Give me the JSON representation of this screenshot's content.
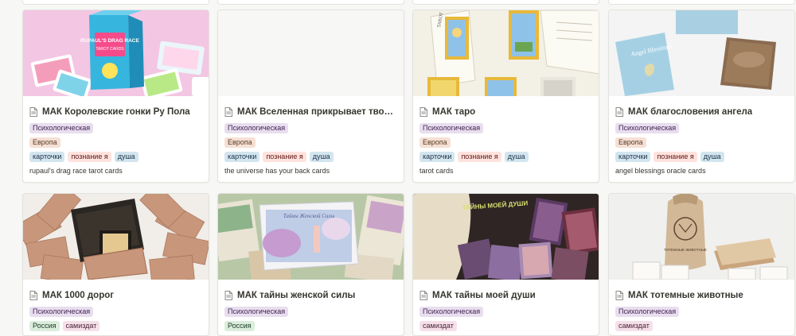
{
  "cards": [
    {
      "title": "МАК Королевские гонки Ру Пола",
      "category": "Психологическая",
      "region": "Европа",
      "tags": [
        "карточки",
        "познание я",
        "душа"
      ],
      "subtitle": "rupaul's drag race tarot cards",
      "cover_text": "RUPAUL'S DRAG RACE"
    },
    {
      "title": "МАК Вселенная прикрывает твою спину",
      "category": "Психологическая",
      "region": "Европа",
      "tags": [
        "карточки",
        "познание я",
        "душа"
      ],
      "subtitle": "the universe has your back cards",
      "cover_text": ""
    },
    {
      "title": "МАК таро",
      "category": "Психологическая",
      "region": "Европа",
      "tags": [
        "карточки",
        "познание я",
        "душа"
      ],
      "subtitle": "tarot cards",
      "cover_text": "TAROT"
    },
    {
      "title": "МАК благословения ангела",
      "category": "Психологическая",
      "region": "Европа",
      "tags": [
        "карточки",
        "познание я",
        "душа"
      ],
      "subtitle": "angel blessings oracle cards",
      "cover_text": "Angel Blessings"
    },
    {
      "title": "МАК 1000 дорог",
      "category": "Психологическая",
      "region": "Россия",
      "tags": [
        "самиздат"
      ]
    },
    {
      "title": "МАК тайны женской силы",
      "category": "Психологическая",
      "region": "Россия",
      "tags": [],
      "cover_text": "Тайны Женской Силы"
    },
    {
      "title": "МАК тайны моей души",
      "category": "Психологическая",
      "region": "",
      "tags": [
        "самиздат"
      ],
      "cover_text": "ТАЙНЫ МОЕЙ ДУШИ"
    },
    {
      "title": "МАК тотемные животные",
      "category": "Психологическая",
      "region": "",
      "tags": [
        "самиздат"
      ],
      "cover_text": "ТОТЕМНЫЕ ЖИВОТНЫЕ"
    }
  ],
  "colors": {
    "background": "#f7f7f5",
    "card_border": "#e3e2de",
    "tag_purple": "#e8deee",
    "tag_orange": "#f5e0d4",
    "tag_green": "#dbeddb",
    "tag_blue": "#d3e5ef",
    "tag_pink": "#f5e0e9",
    "tag_red": "#ffe2dd"
  }
}
